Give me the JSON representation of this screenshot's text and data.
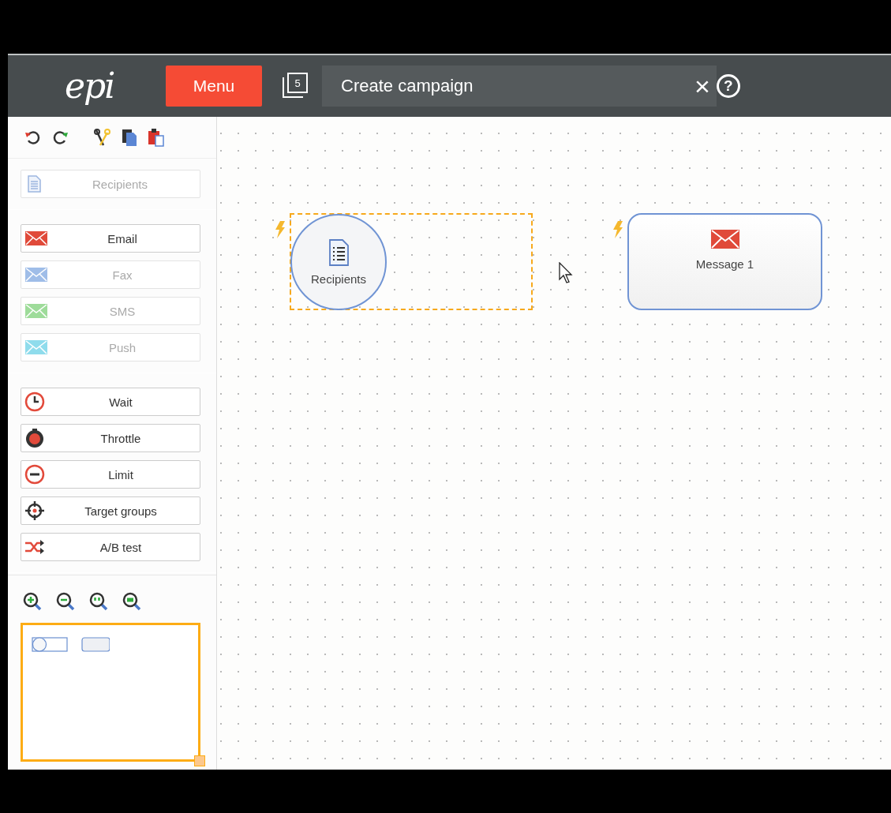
{
  "header": {
    "logo": "epi",
    "menu_button": "Menu",
    "history_badge": "5",
    "title_field": {
      "value": "Create campaign"
    },
    "close": "×",
    "help": "?"
  },
  "toolbar": [
    {
      "kind": "undo"
    },
    {
      "kind": "redo"
    },
    {
      "kind": "cut"
    },
    {
      "kind": "copy"
    },
    {
      "kind": "paste"
    }
  ],
  "palette_groups": [
    [
      {
        "kind": "recipients",
        "label": "Recipients",
        "disabled": true
      }
    ],
    [
      {
        "kind": "mail-red",
        "label": "Email",
        "disabled": false
      },
      {
        "kind": "mail-blue",
        "label": "Fax",
        "disabled": true
      },
      {
        "kind": "mail-green",
        "label": "SMS",
        "disabled": true
      },
      {
        "kind": "mail-cyan",
        "label": "Push",
        "disabled": true
      }
    ],
    [
      {
        "kind": "wait",
        "label": "Wait",
        "disabled": false
      },
      {
        "kind": "throttle",
        "label": "Throttle",
        "disabled": false
      },
      {
        "kind": "limit",
        "label": "Limit",
        "disabled": false
      },
      {
        "kind": "target",
        "label": "Target groups",
        "disabled": false
      },
      {
        "kind": "ab",
        "label": "A/B test",
        "disabled": false
      }
    ]
  ],
  "zoom_buttons": [
    {
      "kind": "in"
    },
    {
      "kind": "out"
    },
    {
      "kind": "fit"
    },
    {
      "kind": "reset"
    }
  ],
  "canvas": {
    "nodes": [
      {
        "kind": "recipients",
        "label": "Recipients",
        "selected": true
      },
      {
        "kind": "message",
        "label": "Message 1",
        "selected": false
      }
    ]
  }
}
